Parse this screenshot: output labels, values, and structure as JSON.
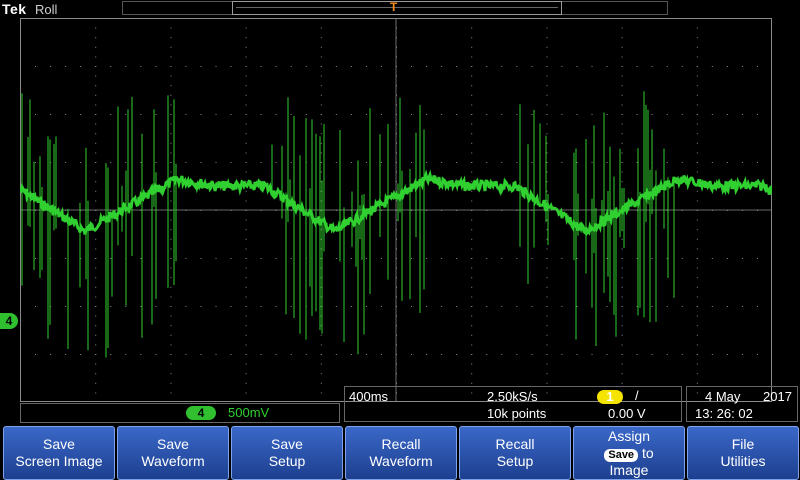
{
  "header": {
    "brand": "Tek",
    "mode": "Roll",
    "trigger_marker": "T"
  },
  "channel": {
    "number": "4",
    "badge": "4",
    "volts_per_div": "500mV",
    "color": "#2fd02f"
  },
  "acquisition": {
    "time_per_div": "400ms",
    "sample_rate": "2.50kS/s",
    "record_length": "10k points",
    "trigger_source": "1",
    "trigger_slope": "/",
    "trigger_level": "0.00 V"
  },
  "datetime": {
    "date": "4 May",
    "year": "2017",
    "time": "13: 26: 02"
  },
  "softkeys": [
    {
      "line1": "Save",
      "line2": "Screen Image"
    },
    {
      "line1": "Save",
      "line2": "Waveform"
    },
    {
      "line1": "Save",
      "line2": "Setup"
    },
    {
      "line1": "Recall",
      "line2": "Waveform"
    },
    {
      "line1": "Recall",
      "line2": "Setup"
    },
    {
      "line1": "Assign",
      "chip": "Save",
      "to": "to",
      "line3": "Image"
    },
    {
      "line1": "File",
      "line2": "Utilities"
    }
  ],
  "colors": {
    "grid": "#8a8a8a",
    "softkey": "#2a55b0",
    "trigger": "#ff8c1a",
    "trace": "#2fd02f"
  }
}
